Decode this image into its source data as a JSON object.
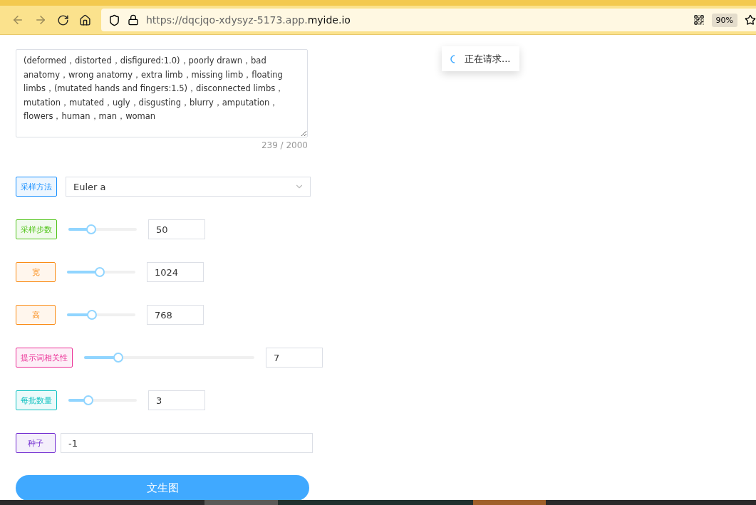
{
  "browser": {
    "url_prefix": "https://dqcjqo-xdysyz-5173.app.",
    "url_domain": "myide.io",
    "zoom": "90%"
  },
  "prompt": {
    "value": "(deformed，distorted，disfigured:1.0)，poorly drawn，bad anatomy，wrong anatomy，extra limb，missing limb，floating limbs，(mutated hands and fingers:1.5)，disconnected limbs，mutation，mutated，ugly，disgusting，blurry，amputation，flowers，human，man，woman",
    "count": "239 / 2000"
  },
  "rows": [
    {
      "kind": "select",
      "label": "采样方法",
      "color": "#1890ff",
      "value": "Euler a"
    },
    {
      "kind": "slider",
      "label": "采样步数",
      "color": "#52c41a",
      "level": 0.33,
      "value": "50"
    },
    {
      "kind": "slider",
      "label": "宽",
      "color": "#fa8c16",
      "level": 0.48,
      "value": "1024"
    },
    {
      "kind": "slider",
      "label": "高",
      "color": "#fa8c16",
      "level": 0.36,
      "value": "768"
    },
    {
      "kind": "slider",
      "label": "提示词相关性",
      "color": "#eb2f96",
      "level": 0.2,
      "value": "7",
      "wide": true
    },
    {
      "kind": "slider",
      "label": "每批数量",
      "color": "#13c2c2",
      "level": 0.29,
      "value": "3"
    },
    {
      "kind": "input",
      "label": "种子",
      "color": "#722ed1",
      "value": "-1"
    }
  ],
  "submit": "文生图",
  "toast": "正在请求..."
}
